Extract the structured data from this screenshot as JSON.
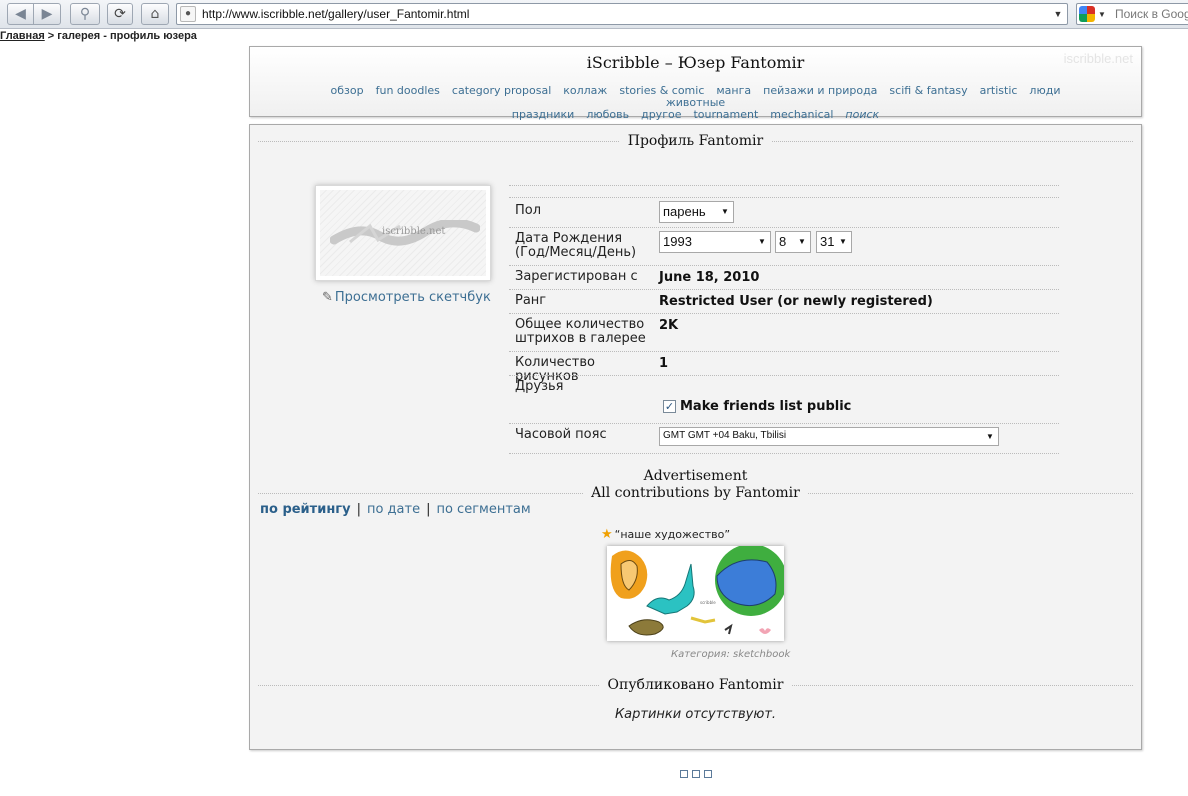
{
  "browser": {
    "url": "http://www.iscribble.net/gallery/user_Fantomir.html",
    "search_placeholder": "Поиск в Google",
    "icons": [
      "back-icon",
      "forward-icon",
      "key-icon",
      "reload-icon",
      "home-icon",
      "site-icon",
      "google-icon"
    ]
  },
  "breadcrumb": {
    "home": "Главная",
    "rest": " > галерея - профиль юзера"
  },
  "header": {
    "title": "iScribble – Юзер Fantomir",
    "watermark": "iscribble.net",
    "categories": [
      "обзор",
      "fun doodles",
      "category proposal",
      "коллаж",
      "stories & comic",
      "манга",
      "пейзажи и природа",
      "scifi & fantasy",
      "artistic",
      "люди",
      "животные",
      "праздники",
      "любовь",
      "другое",
      "tournament",
      "mechanical"
    ],
    "search_link": "поиск"
  },
  "profile": {
    "section_title": "Профиль Fantomir",
    "avatar_text": "iscribble.net",
    "sketchbook_link": "Просмотреть скетчбук",
    "gender": {
      "label": "Пол",
      "value": "парень"
    },
    "birthdate": {
      "label": "Дата Рождения (Год/Месяц/День)",
      "year": "1993",
      "month": "8",
      "day": "31"
    },
    "registered": {
      "label": "Зарегистирован с",
      "value": "June 18, 2010"
    },
    "rank": {
      "label": "Ранг",
      "value": "Restricted User (or newly registered)"
    },
    "strokes": {
      "label": "Общее количество штрихов в галерее",
      "value": "2K"
    },
    "drawings": {
      "label": "Количество рисунков",
      "value": "1"
    },
    "friends": {
      "label": "Друзья",
      "checkbox_label": "Make friends list public",
      "checked": true
    },
    "timezone": {
      "label": "Часовой пояс",
      "value": "GMT GMT +04 Baku, Tbilisi"
    }
  },
  "advertisement": "Advertisement",
  "contributions": {
    "title": "All contributions by Fantomir",
    "sort": {
      "rating": "по рейтингу",
      "date": "по дате",
      "segments": "по сегментам",
      "sep": "|"
    },
    "drawing": {
      "title": "“наше художество”",
      "category": "Категория: sketchbook"
    }
  },
  "published": {
    "title": "Опубликовано Fantomir",
    "empty": "Картинки отсутствуют."
  },
  "colors": {
    "link": "#3d6f93",
    "panel_bg": "#f3f3f3"
  }
}
